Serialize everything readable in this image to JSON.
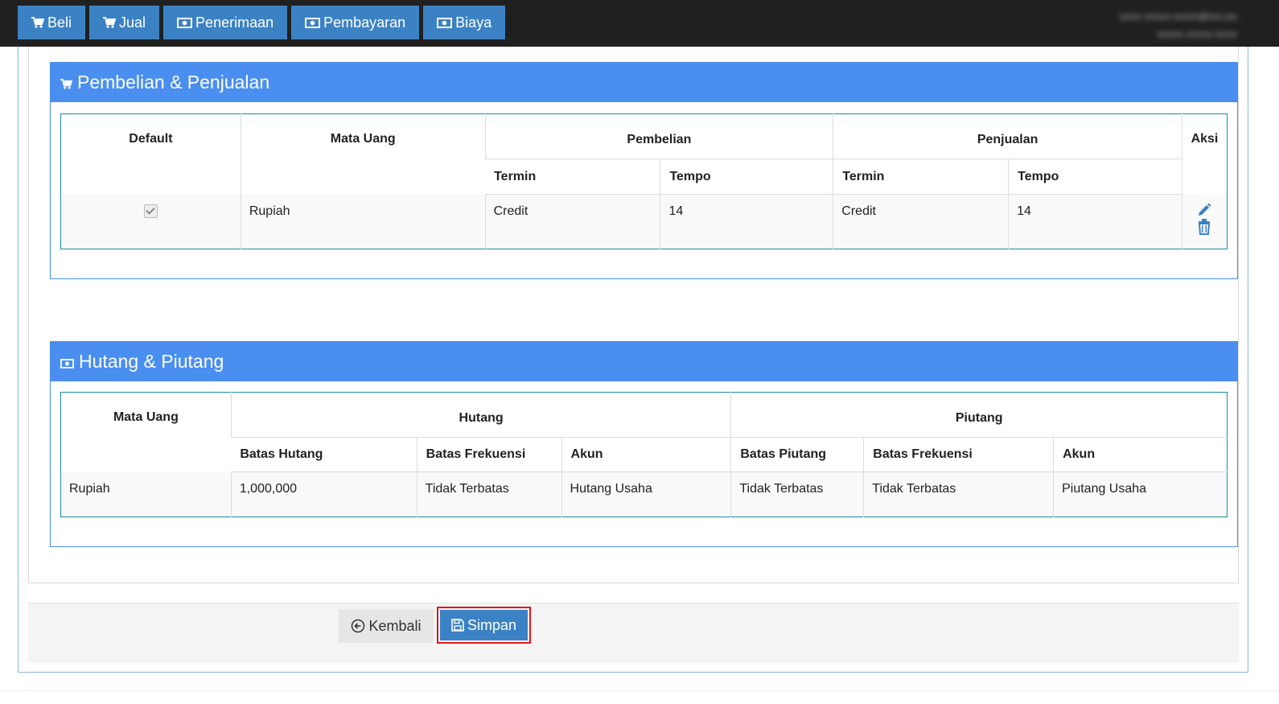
{
  "topnav": {
    "items": [
      {
        "label": "Beli",
        "icon": "cart-icon"
      },
      {
        "label": "Jual",
        "icon": "cart-icon"
      },
      {
        "label": "Penerimaan",
        "icon": "money-icon"
      },
      {
        "label": "Pembayaran",
        "icon": "money-icon"
      },
      {
        "label": "Biaya",
        "icon": "money-icon"
      }
    ],
    "user_line1": "xxxxx xxxxxx xxxxxx@xxx.xxx",
    "user_line2": "xxxxxx xxxxxx xxxxx"
  },
  "pembelian_panel": {
    "title": "Pembelian & Penjualan",
    "headers": {
      "default": "Default",
      "mata_uang": "Mata Uang",
      "pembelian": "Pembelian",
      "penjualan": "Penjualan",
      "aksi": "Aksi",
      "termin": "Termin",
      "tempo": "Tempo"
    },
    "row": {
      "default_checked": true,
      "mata_uang": "Rupiah",
      "pembelian_termin": "Credit",
      "pembelian_tempo": "14",
      "penjualan_termin": "Credit",
      "penjualan_tempo": "14"
    }
  },
  "hutang_panel": {
    "title": "Hutang & Piutang",
    "headers": {
      "mata_uang": "Mata Uang",
      "hutang": "Hutang",
      "piutang": "Piutang",
      "batas_hutang": "Batas Hutang",
      "batas_frekuensi": "Batas Frekuensi",
      "akun": "Akun",
      "batas_piutang": "Batas Piutang"
    },
    "row": {
      "mata_uang": "Rupiah",
      "batas_hutang": "1,000,000",
      "hutang_batas_frekuensi": "Tidak Terbatas",
      "hutang_akun": "Hutang Usaha",
      "batas_piutang": "Tidak Terbatas",
      "piutang_batas_frekuensi": "Tidak Terbatas",
      "piutang_akun": "Piutang Usaha"
    }
  },
  "footer": {
    "back_label": "Kembali",
    "save_label": "Simpan"
  },
  "colors": {
    "accent": "#3b82c4",
    "panel_header": "#4a8ef0",
    "highlight": "#e0161c"
  }
}
